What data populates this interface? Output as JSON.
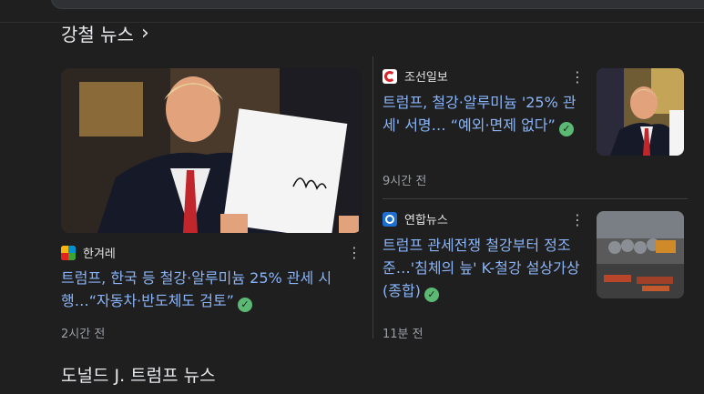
{
  "section": {
    "title": "강철 뉴스"
  },
  "articles": [
    {
      "source": "한겨레",
      "headline": "트럼프, 한국 등 철강·알루미늄 25% 관세 시행…“자동차·반도체도 검토”",
      "time": "2시간 전"
    },
    {
      "source": "조선일보",
      "headline": "트럼프, 철강·알루미늄 '25% 관세' 서명… “예외·면제 없다”",
      "time": "9시간 전"
    },
    {
      "source": "연합뉴스",
      "headline": "트럼프 관세전쟁 철강부터 정조준…'침체의 늪' K-철강 설상가상(종합)",
      "time": "11분 전"
    }
  ],
  "next_section": {
    "title": "도널드 J. 트럼프 뉴스"
  },
  "colors": {
    "background": "#1f1f1f",
    "link": "#8ab4f8",
    "verified": "#5bb974",
    "muted": "#9aa0a6"
  },
  "icons": {
    "more": "more-vert-icon",
    "verified": "verified-check-icon",
    "chevron": "chevron-right-icon"
  }
}
